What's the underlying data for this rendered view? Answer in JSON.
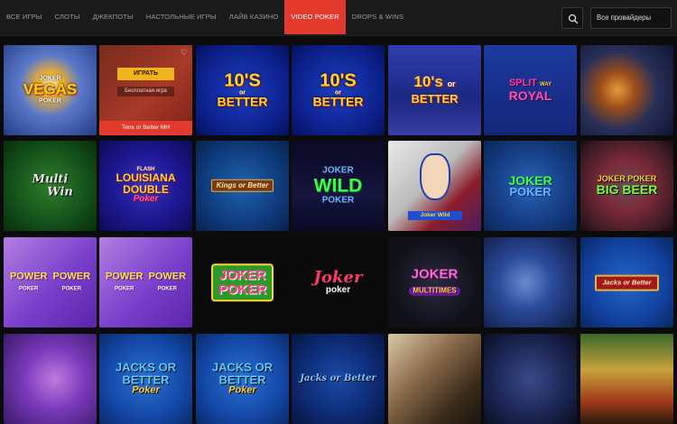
{
  "nav": {
    "tabs": [
      {
        "label": "ВСЕ ИГРЫ"
      },
      {
        "label": "СЛОТЫ"
      },
      {
        "label": "ДЖЕКПОТЫ"
      },
      {
        "label": "НАСТОЛЬНЫЕ ИГРЫ"
      },
      {
        "label": "ЛАЙВ КАЗИНО"
      },
      {
        "label": "VIDEO POKER"
      },
      {
        "label": "DROPS & WINS"
      }
    ],
    "active_tab": "VIDEO POKER",
    "provider_select": "Все провайдеры",
    "search_icon": "search-icon",
    "accent_color": "#e23b2e"
  },
  "hover_card": {
    "play_label": "ИГРАТЬ",
    "demo_label": "Бесплатная игра",
    "name": "Tens or Better MH",
    "favorite_icon": "heart-icon"
  },
  "games": [
    {
      "title": "JOKER VEGAS POKER"
    },
    {
      "title": "Tens or Better MH"
    },
    {
      "title": "10'S OR BETTER",
      "line1": "10'S",
      "line2": "BETTER"
    },
    {
      "title": "10'S OR BETTER",
      "line1": "10'S",
      "line2": "BETTER"
    },
    {
      "title": "10's or BETTER"
    },
    {
      "title": "SPLIT WAY ROYAL"
    },
    {
      "title": ""
    },
    {
      "title": "Multi Win"
    },
    {
      "title": "FLASH LOUISIANA DOUBLE Poker"
    },
    {
      "title": "Kings or Better"
    },
    {
      "title": "JOKER WILD POKER"
    },
    {
      "title": "Joker Wild"
    },
    {
      "title": "JOKER POKER"
    },
    {
      "title": "JOKER POKER BIG BEER"
    },
    {
      "title": "POWER POKER"
    },
    {
      "title": "POWER POKER"
    },
    {
      "title": "JOKER POKER"
    },
    {
      "title": "Joker poker"
    },
    {
      "title": "JOKER MULTITIMES"
    },
    {
      "title": ""
    },
    {
      "title": "Jacks or Better"
    },
    {
      "title": ""
    },
    {
      "title": "JACKS OR BETTER Poker"
    },
    {
      "title": "JACKS OR BETTER Poker"
    },
    {
      "title": "Jacks or Better"
    },
    {
      "title": ""
    },
    {
      "title": ""
    },
    {
      "title": ""
    }
  ]
}
